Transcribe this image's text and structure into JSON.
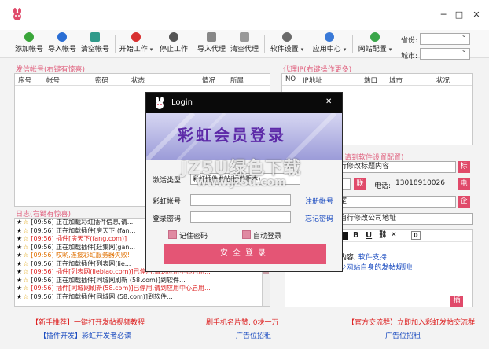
{
  "window": {
    "min": "─",
    "max": "□",
    "close": "✕"
  },
  "toolbar": {
    "add_account": "添加帐号",
    "import_account": "导入帐号",
    "clear_account": "清空帐号",
    "start_work": "开始工作",
    "stop_work": "停止工作",
    "import_proxy": "导入代理",
    "clear_proxy": "清空代理",
    "software_settings": "软件设置",
    "app_center": "应用中心",
    "site_config": "网站配置",
    "province_label": "省份:",
    "city_label": "城市:",
    "caret": "▾"
  },
  "accounts": {
    "title": "发信帐号(右键有惊喜)",
    "headers": [
      "序号",
      "帐号",
      "密码",
      "状态",
      "情况",
      "所属"
    ]
  },
  "proxy": {
    "title": "代理IP(右键操作更多)",
    "headers": [
      "NO",
      "IP地址",
      "端口",
      "城市",
      "状况"
    ]
  },
  "settings_hint": "请到软件设置配置)",
  "right": {
    "title_field": "行修改标题内容",
    "tag1": "标",
    "tag_contact": "联",
    "phone_label": "电话:",
    "phone_value": "13018910026",
    "tag2": "电",
    "room_field": "室",
    "tag3": "企",
    "address_field": "自行修改公司地址"
  },
  "editor": {
    "btn_bold": "B",
    "btn_underline": "U",
    "btn_link": "⛓",
    "btn_x": "✕",
    "btn_zero": "0",
    "text_line1": "请自行修改描述内容, ",
    "text_line1_blue": "软件支持",
    "text_line2_blue": "html代码, 请至少网站自身的发帖规则!",
    "tag": "插"
  },
  "log": {
    "title": "日志(右键有惊喜)",
    "lines": [
      "[09:56] 正在加载彩虹插件信息,请...",
      "[09:56] 正在加载插件[房天下 (fan...",
      "[09:56] 插件[房天下(fang.com)]",
      "[09:56] 正在加载插件[赶集网(gan...",
      "[09:56] 哎哟,连接彩虹服务器失败!",
      "[09:56] 正在加载插件[列表网(lie...",
      "[09:56] 插件[列表网(liebiao.com)]已停用,请到应用中心启用...",
      "[09:56] 正在加载插件[同城网刷新 (58.com)]到软件...",
      "[09:56] 插件[同城网刷新(58.com)]已停用,请到应用中心启用...",
      "[09:56] 正在加载插件[同城网 (58.com)]到软件..."
    ]
  },
  "footer": {
    "l1_red": "【新手推荐】一键打开发帖视频教程",
    "l1_mid": "刷手机名片赞, 0块一万",
    "l1_right": "【官方交流群】立即加入彩虹发帖交流群",
    "l2_left": "【插件开发】彩虹开发者必读",
    "l2_mid": "广告位招租",
    "l2_right": "广告位招租"
  },
  "login": {
    "title": "Login",
    "win_min": "─",
    "win_close": "✕",
    "banner_text": "彩虹会员登录",
    "activation_label": "激活类型:",
    "activation_value": "彩虹插件发帖(插件版本)",
    "account_label": "彩虹帐号:",
    "register_link": "注册帐号",
    "password_label": "登录密码:",
    "forgot_link": "忘记密码",
    "remember_label": "记住密码",
    "autologin_label": "自动登录",
    "login_button": "安全登录"
  },
  "watermark": {
    "line1": "JZ5U绿色下载",
    "line2": "www.jz5u.com"
  }
}
